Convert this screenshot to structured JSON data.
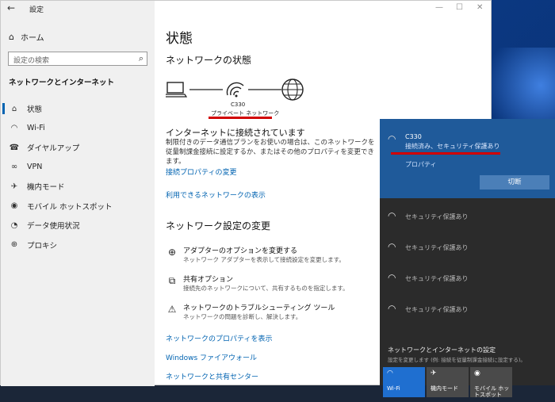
{
  "window": {
    "back_glyph": "←",
    "title": "設定",
    "controls": {
      "minimize": "—",
      "maximize": "☐",
      "close": "✕"
    }
  },
  "sidebar": {
    "home": "ホーム",
    "home_icon": "home-icon",
    "search_placeholder": "設定の検索",
    "section": "ネットワークとインターネット",
    "items": [
      {
        "label": "状態",
        "icon": "status-icon",
        "glyph": "⌂",
        "active": true
      },
      {
        "label": "Wi-Fi",
        "icon": "wifi-icon",
        "glyph": "◠"
      },
      {
        "label": "ダイヤルアップ",
        "icon": "dialup-icon",
        "glyph": "☎"
      },
      {
        "label": "VPN",
        "icon": "vpn-icon",
        "glyph": "∞"
      },
      {
        "label": "機内モード",
        "icon": "airplane-icon",
        "glyph": "✈"
      },
      {
        "label": "モバイル ホットスポット",
        "icon": "hotspot-icon",
        "glyph": "◉"
      },
      {
        "label": "データ使用状況",
        "icon": "data-usage-icon",
        "glyph": "◔"
      },
      {
        "label": "プロキシ",
        "icon": "proxy-icon",
        "glyph": "⊕"
      }
    ]
  },
  "main": {
    "title": "状態",
    "network_status_heading": "ネットワークの状態",
    "ssid": "C330",
    "profile": "プライベート ネットワーク",
    "status_title": "インターネットに接続されています",
    "status_desc": "制限付きのデータ通信プランをお使いの場合は、このネットワークを従量制課金接続に設定するか、またはその他のプロパティを変更できます。",
    "link_properties": "接続プロパティの変更",
    "link_available": "利用できるネットワークの表示",
    "settings_heading": "ネットワーク設定の変更",
    "options": [
      {
        "title": "アダプターのオプションを変更する",
        "sub": "ネットワーク アダプターを表示して接続設定を変更します。",
        "icon": "adapter-icon",
        "glyph": "⊕"
      },
      {
        "title": "共有オプション",
        "sub": "接続先のネットワークについて、共有するものを指定します。",
        "icon": "sharing-icon",
        "glyph": "⧉"
      },
      {
        "title": "ネットワークのトラブルシューティング ツール",
        "sub": "ネットワークの問題を診断し、解決します。",
        "icon": "warning-icon",
        "glyph": "⚠"
      }
    ],
    "links_bottom": [
      "ネットワークのプロパティを表示",
      "Windows ファイアウォール",
      "ネットワークと共有センター"
    ]
  },
  "flyout": {
    "connected_ssid": "C330",
    "connected_state": "接続済み、セキュリティ保護あり",
    "properties": "プロパティ",
    "disconnect": "切断",
    "networks": [
      "セキュリティ保護あり",
      "セキュリティ保護あり",
      "セキュリティ保護あり",
      "セキュリティ保護あり"
    ],
    "settings_title": "ネットワークとインターネットの設定",
    "settings_sub": "設定を変更します (例: 接続を従量制課金接続に設定する)。",
    "quick_actions": [
      {
        "label": "Wi-Fi",
        "icon": "wifi-icon",
        "glyph": "◠",
        "active": true
      },
      {
        "label": "機内モード",
        "icon": "airplane-icon",
        "glyph": "✈",
        "active": false
      },
      {
        "label": "モバイル ホットスポット",
        "icon": "hotspot-icon",
        "glyph": "◉",
        "active": false
      }
    ]
  },
  "colors": {
    "accent": "#0063b1",
    "highlight": "#d10000",
    "flyout_top": "#1f5a9a",
    "flyout_bg": "#2b2b2b"
  }
}
